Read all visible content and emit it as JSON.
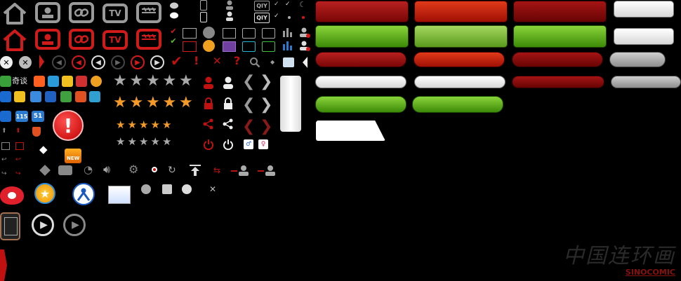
{
  "labels": {
    "tv": "TV",
    "qiy": "QIY",
    "qiyi_brand": "奇谈",
    "new_badge": "NEW",
    "num_115": "115",
    "num_51": "51",
    "watermark_cn": "中国连环画",
    "watermark_en": "SINOCOMIC"
  },
  "colors": {
    "icon_gray": "#9a9a9a",
    "icon_red": "#d11a1a",
    "button_red": "#8e0d0d",
    "button_green": "#5fae20",
    "button_white": "#f0f0f0",
    "background": "#000000"
  },
  "icons": {
    "row1": [
      "home-icon",
      "user-card-icon",
      "link-icon",
      "tv-icon",
      "clapper-icon"
    ],
    "stars_rows": [
      5,
      5,
      5,
      5
    ]
  }
}
